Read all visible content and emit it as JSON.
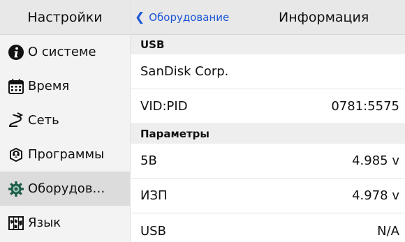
{
  "sidebar": {
    "title": "Настройки",
    "items": [
      {
        "label": "О системе",
        "icon": "info-icon"
      },
      {
        "label": "Время",
        "icon": "calendar-icon"
      },
      {
        "label": "Сеть",
        "icon": "network-icon"
      },
      {
        "label": "Программы",
        "icon": "package-icon"
      },
      {
        "label": "Оборудов…",
        "icon": "gear-icon",
        "selected": true
      },
      {
        "label": "Язык",
        "icon": "map-icon"
      }
    ]
  },
  "header": {
    "back_label": "Оборудование",
    "title": "Информация"
  },
  "sections": [
    {
      "title": "USB",
      "rows": [
        {
          "label": "SanDisk Corp.",
          "value": ""
        },
        {
          "label": "VID:PID",
          "value": "0781:5575"
        }
      ]
    },
    {
      "title": "Параметры",
      "rows": [
        {
          "label": "5В",
          "value": "4.985 v"
        },
        {
          "label": "ИЗП",
          "value": "4.978 v"
        },
        {
          "label": "USB",
          "value": "N/A"
        }
      ]
    }
  ],
  "colors": {
    "accent": "#1a55d6",
    "sidebar_bg": "#f3f3f3",
    "header_bg": "#e8e8e8",
    "selected_bg": "#dcdcdc"
  }
}
